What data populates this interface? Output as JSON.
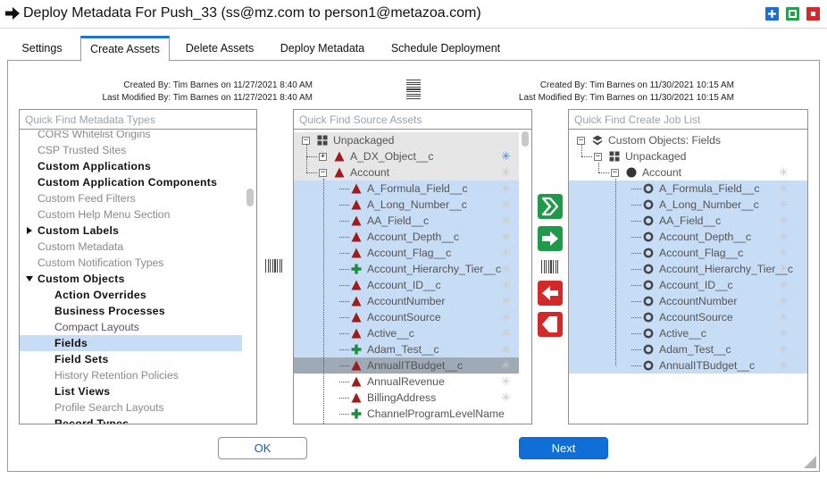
{
  "window": {
    "title": "Deploy Metadata For Push_33 (ss@mz.com to person1@metazoa.com)",
    "buttons": [
      "maximize-icon",
      "restore-icon",
      "close-icon"
    ],
    "colors": {
      "maximize": "#1f6fd1",
      "restore": "#26a04a",
      "close": "#d22a2a"
    }
  },
  "tabs": [
    {
      "label": "Settings"
    },
    {
      "label": "Create Assets",
      "active": true
    },
    {
      "label": "Delete Assets"
    },
    {
      "label": "Deploy Metadata"
    },
    {
      "label": "Schedule Deployment"
    }
  ],
  "source_info": {
    "created": "Created By: Tim Barnes on 11/27/2021 8:40 AM",
    "modified": "Last Modified By: Tim Barnes on 11/27/2021 8:40 AM"
  },
  "target_info": {
    "created": "Created By: Tim Barnes on 11/30/2021 10:15 AM",
    "modified": "Last Modified By: Tim Barnes on 11/30/2021 10:15 AM"
  },
  "metadata_types": {
    "placeholder": "Quick Find Metadata Types",
    "items": [
      {
        "label": "CORS Whitelist Origins",
        "style": "grey",
        "level": 0
      },
      {
        "label": "CSP Trusted Sites",
        "style": "grey",
        "level": 0
      },
      {
        "label": "Custom Applications",
        "style": "bold",
        "level": 0
      },
      {
        "label": "Custom Application Components",
        "style": "bold",
        "level": 0
      },
      {
        "label": "Custom Feed Filters",
        "style": "grey",
        "level": 0
      },
      {
        "label": "Custom Help Menu Section",
        "style": "grey",
        "level": 0
      },
      {
        "label": "Custom Labels",
        "style": "bold",
        "level": 0,
        "expander": "collapsed"
      },
      {
        "label": "Custom Metadata",
        "style": "grey",
        "level": 0
      },
      {
        "label": "Custom Notification Types",
        "style": "grey",
        "level": 0
      },
      {
        "label": "Custom Objects",
        "style": "bold",
        "level": 0,
        "expander": "expanded"
      },
      {
        "label": "Action Overrides",
        "style": "bold",
        "level": 1
      },
      {
        "label": "Business Processes",
        "style": "bold",
        "level": 1
      },
      {
        "label": "Compact Layouts",
        "style": "normal",
        "level": 1
      },
      {
        "label": "Fields",
        "style": "bold",
        "level": 1,
        "selected": true
      },
      {
        "label": "Field Sets",
        "style": "bold",
        "level": 1
      },
      {
        "label": "History Retention Policies",
        "style": "grey",
        "level": 1
      },
      {
        "label": "List Views",
        "style": "bold",
        "level": 1
      },
      {
        "label": "Profile Search Layouts",
        "style": "grey",
        "level": 1
      },
      {
        "label": "Record Types",
        "style": "bold",
        "level": 1
      }
    ]
  },
  "source_assets": {
    "placeholder": "Quick Find Source Assets",
    "root": "Unpackaged",
    "items": [
      {
        "label": "A_DX_Object__c",
        "icon": "red-triangle-icon",
        "level": 1,
        "expander": "+",
        "star": "blue"
      },
      {
        "label": "Account",
        "icon": "red-triangle-icon",
        "level": 1,
        "expander": "-",
        "star": "grey"
      },
      {
        "label": "A_Formula_Field__c",
        "icon": "red-triangle-icon",
        "level": 2,
        "selected": true,
        "star": "grey"
      },
      {
        "label": "A_Long_Number__c",
        "icon": "red-triangle-icon",
        "level": 2,
        "selected": true,
        "star": "grey"
      },
      {
        "label": "AA_Field__c",
        "icon": "red-triangle-icon",
        "level": 2,
        "selected": true,
        "star": "grey"
      },
      {
        "label": "Account_Depth__c",
        "icon": "red-triangle-icon",
        "level": 2,
        "selected": true,
        "star": "grey"
      },
      {
        "label": "Account_Flag__c",
        "icon": "red-triangle-icon",
        "level": 2,
        "selected": true,
        "star": "grey"
      },
      {
        "label": "Account_Hierarchy_Tier__c",
        "icon": "green-plus-icon",
        "level": 2,
        "selected": true,
        "star": "grey"
      },
      {
        "label": "Account_ID__c",
        "icon": "red-triangle-icon",
        "level": 2,
        "selected": true,
        "star": "grey"
      },
      {
        "label": "AccountNumber",
        "icon": "red-triangle-icon",
        "level": 2,
        "selected": true,
        "star": "grey"
      },
      {
        "label": "AccountSource",
        "icon": "red-triangle-icon",
        "level": 2,
        "selected": true,
        "star": "grey"
      },
      {
        "label": "Active__c",
        "icon": "red-triangle-icon",
        "level": 2,
        "selected": true,
        "star": "grey"
      },
      {
        "label": "Adam_Test__c",
        "icon": "green-plus-icon",
        "level": 2,
        "selected": true,
        "star": "grey"
      },
      {
        "label": "AnnualITBudget__c",
        "icon": "red-triangle-icon",
        "level": 2,
        "focused": true,
        "star": "grey"
      },
      {
        "label": "AnnualRevenue",
        "icon": "red-triangle-icon",
        "level": 2,
        "star": "grey"
      },
      {
        "label": "BillingAddress",
        "icon": "red-triangle-icon",
        "level": 2,
        "star": "grey"
      },
      {
        "label": "ChannelProgramLevelName",
        "icon": "green-plus-icon",
        "level": 2,
        "star": "none"
      }
    ]
  },
  "create_job_list": {
    "placeholder": "Quick Find Create Job List",
    "items": [
      {
        "label": "Custom Objects: Fields",
        "icon": "stack-icon",
        "level": 0,
        "expander": "-"
      },
      {
        "label": "Unpackaged",
        "icon": "package-icon",
        "level": 1,
        "expander": "-"
      },
      {
        "label": "Account",
        "icon": "black-dot-icon",
        "level": 2,
        "expander": "-",
        "star": "grey"
      },
      {
        "label": "A_Formula_Field__c",
        "level": 3,
        "selected": true
      },
      {
        "label": "A_Long_Number__c",
        "level": 3,
        "selected": true
      },
      {
        "label": "AA_Field__c",
        "level": 3,
        "selected": true
      },
      {
        "label": "Account_Depth__c",
        "level": 3,
        "selected": true
      },
      {
        "label": "Account_Flag__c",
        "level": 3,
        "selected": true
      },
      {
        "label": "Account_Hierarchy_Tier__c",
        "level": 3,
        "selected": true
      },
      {
        "label": "Account_ID__c",
        "level": 3,
        "selected": true
      },
      {
        "label": "AccountNumber",
        "level": 3,
        "selected": true
      },
      {
        "label": "AccountSource",
        "level": 3,
        "selected": true
      },
      {
        "label": "Active__c",
        "level": 3,
        "selected": true
      },
      {
        "label": "Adam_Test__c",
        "level": 3,
        "selected": true
      },
      {
        "label": "AnnualITBudget__c",
        "level": 3,
        "selected": true
      }
    ]
  },
  "transfer_buttons": [
    "move-all-right-icon",
    "move-right-icon",
    "move-left-icon",
    "move-all-left-icon"
  ],
  "transfer_colors": {
    "add": "#1f9a4a",
    "remove": "#d22a2a"
  },
  "footer": {
    "ok_label": "OK",
    "next_label": "Next"
  }
}
